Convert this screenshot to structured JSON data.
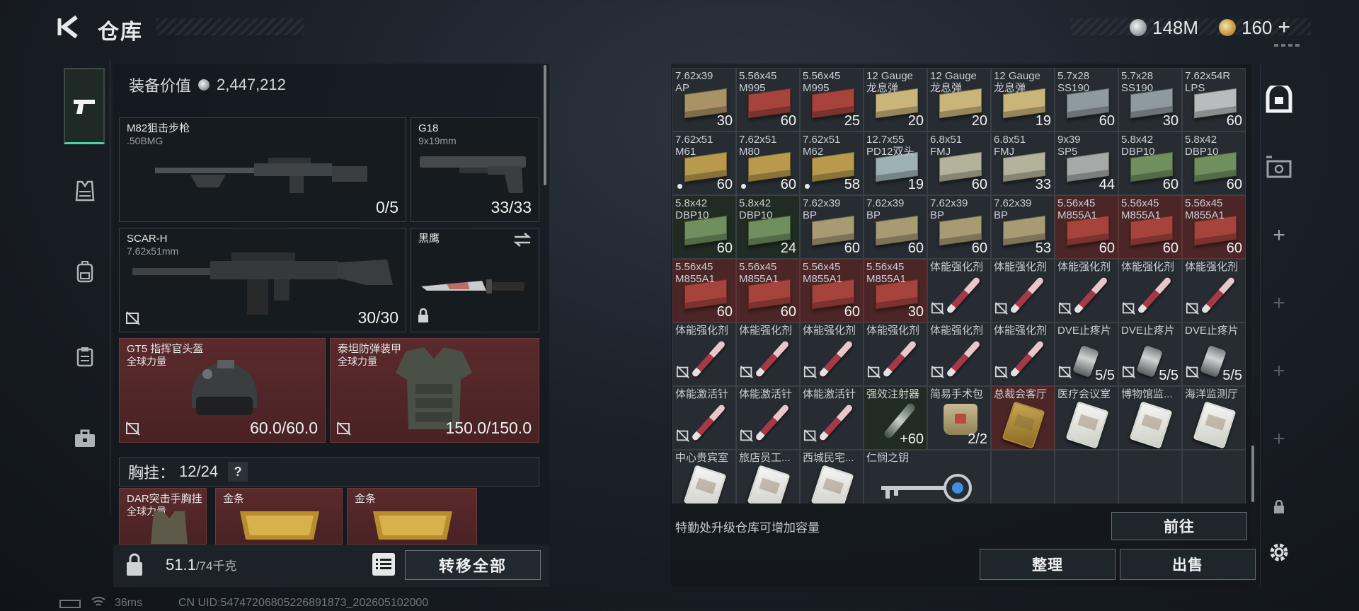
{
  "header": {
    "title": "仓库",
    "silver": "148M",
    "gold": "160"
  },
  "equipment": {
    "value_label": "装备价值",
    "value": "2,447,212",
    "primary1": {
      "name": "M82狙击步枪",
      "caliber": ".50BMG",
      "ammo": "0/5"
    },
    "sidearm": {
      "name": "G18",
      "caliber": "9x19mm",
      "ammo": "33/33"
    },
    "primary2": {
      "name": "SCAR-H",
      "caliber": "7.62x51mm",
      "ammo": "30/30"
    },
    "melee": {
      "name": "黑鹰"
    },
    "helmet": {
      "name": "GT5 指挥官头盔",
      "sub": "全球力量",
      "durability": "60.0/60.0"
    },
    "armor": {
      "name": "泰坦防弹装甲",
      "sub": "全球力量",
      "durability": "150.0/150.0"
    },
    "vest": {
      "label": "胸挂：",
      "count": "12/24"
    },
    "vest_items": [
      {
        "name": "DAR突击手胸挂",
        "sub": "全球力量"
      },
      {
        "name": "金条"
      },
      {
        "name": "金条"
      }
    ],
    "weight": "51.1",
    "weight_max": "/74千克",
    "transfer_all": "转移全部"
  },
  "status": {
    "ping": "36ms",
    "uid": "CN UID:54747206805226891873_202605102000"
  },
  "stash": {
    "rows": [
      [
        {
          "t": "7.62x39\nAP",
          "q": "30",
          "kind": "ammo",
          "color": "#a89266"
        },
        {
          "t": "5.56x45\nM995",
          "q": "60",
          "kind": "ammo",
          "color": "#a6433c"
        },
        {
          "t": "5.56x45\nM995",
          "q": "25",
          "kind": "ammo",
          "color": "#a6433c"
        },
        {
          "t": "12 Gauge\n龙息弹",
          "q": "20",
          "kind": "ammo",
          "color": "#c9b47a"
        },
        {
          "t": "12 Gauge\n龙息弹",
          "q": "20",
          "kind": "ammo",
          "color": "#c9b47a"
        },
        {
          "t": "12 Gauge\n龙息弹",
          "q": "19",
          "kind": "ammo",
          "color": "#c9b47a"
        },
        {
          "t": "5.7x28\nSS190",
          "q": "60",
          "kind": "ammo",
          "color": "#8f9aa0"
        },
        {
          "t": "5.7x28\nSS190",
          "q": "30",
          "kind": "ammo",
          "color": "#8f9aa0"
        },
        {
          "t": "7.62x54R\nLPS",
          "q": "60",
          "kind": "ammo",
          "color": "#b9bcbd"
        }
      ],
      [
        {
          "t": "7.62x51\nM61",
          "q": "60",
          "kind": "ammo",
          "color": "#b89a4c",
          "dot": true
        },
        {
          "t": "7.62x51\nM80",
          "q": "60",
          "kind": "ammo",
          "color": "#b89a4c",
          "dot": true
        },
        {
          "t": "7.62x51\nM62",
          "q": "58",
          "kind": "ammo",
          "color": "#b89a4c",
          "dot": true
        },
        {
          "t": "12.7x55\nPD12双头",
          "q": "19",
          "kind": "ammo",
          "color": "#9fb0b4"
        },
        {
          "t": "6.8x51\nFMJ",
          "q": "60",
          "kind": "ammo",
          "color": "#b4b29a"
        },
        {
          "t": "6.8x51\nFMJ",
          "q": "33",
          "kind": "ammo",
          "color": "#b4b29a"
        },
        {
          "t": "9x39\nSP5",
          "q": "44",
          "kind": "ammo",
          "color": "#a5a9a8"
        },
        {
          "t": "5.8x42\nDBP10",
          "q": "60",
          "kind": "ammo",
          "color": "#6f8f5e"
        },
        {
          "t": "5.8x42\nDBP10",
          "q": "60",
          "kind": "ammo",
          "color": "#6f8f5e"
        }
      ],
      [
        {
          "t": "5.8x42\nDBP10",
          "q": "60",
          "kind": "ammo",
          "color": "#6f8f5e",
          "cell": "green"
        },
        {
          "t": "5.8x42\nDBP10",
          "q": "24",
          "kind": "ammo",
          "color": "#6f8f5e",
          "cell": "green"
        },
        {
          "t": "7.62x39\nBP",
          "q": "60",
          "kind": "ammo",
          "color": "#a89a72"
        },
        {
          "t": "7.62x39\nBP",
          "q": "60",
          "kind": "ammo",
          "color": "#a89a72"
        },
        {
          "t": "7.62x39\nBP",
          "q": "60",
          "kind": "ammo",
          "color": "#a89a72"
        },
        {
          "t": "7.62x39\nBP",
          "q": "53",
          "kind": "ammo",
          "color": "#a89a72"
        },
        {
          "t": "5.56x45\nM855A1",
          "q": "60",
          "kind": "ammo",
          "color": "#a6433c",
          "cell": "red"
        },
        {
          "t": "5.56x45\nM855A1",
          "q": "60",
          "kind": "ammo",
          "color": "#a6433c",
          "cell": "red"
        },
        {
          "t": "5.56x45\nM855A1",
          "q": "60",
          "kind": "ammo",
          "color": "#a6433c",
          "cell": "red"
        }
      ],
      [
        {
          "t": "5.56x45\nM855A1",
          "q": "60",
          "kind": "ammo",
          "color": "#a6433c",
          "cell": "red"
        },
        {
          "t": "5.56x45\nM855A1",
          "q": "60",
          "kind": "ammo",
          "color": "#a6433c",
          "cell": "red"
        },
        {
          "t": "5.56x45\nM855A1",
          "q": "60",
          "kind": "ammo",
          "color": "#a6433c",
          "cell": "red"
        },
        {
          "t": "5.56x45\nM855A1",
          "q": "30",
          "kind": "ammo",
          "color": "#a6433c",
          "cell": "red"
        },
        {
          "t": "体能强化剂",
          "q": "",
          "kind": "syringe",
          "nd": true
        },
        {
          "t": "体能强化剂",
          "q": "",
          "kind": "syringe",
          "nd": true
        },
        {
          "t": "体能强化剂",
          "q": "",
          "kind": "syringe",
          "nd": true
        },
        {
          "t": "体能强化剂",
          "q": "",
          "kind": "syringe",
          "nd": true
        },
        {
          "t": "体能强化剂",
          "q": "",
          "kind": "syringe",
          "nd": true
        }
      ],
      [
        {
          "t": "体能强化剂",
          "q": "",
          "kind": "syringe",
          "nd": true
        },
        {
          "t": "体能强化剂",
          "q": "",
          "kind": "syringe",
          "nd": true
        },
        {
          "t": "体能强化剂",
          "q": "",
          "kind": "syringe",
          "nd": true
        },
        {
          "t": "体能强化剂",
          "q": "",
          "kind": "syringe",
          "nd": true
        },
        {
          "t": "体能强化剂",
          "q": "",
          "kind": "syringe",
          "nd": true
        },
        {
          "t": "体能强化剂",
          "q": "",
          "kind": "syringe",
          "nd": true
        },
        {
          "t": "DVE止疼片",
          "q": "5/5",
          "kind": "pill",
          "nd": true
        },
        {
          "t": "DVE止疼片",
          "q": "5/5",
          "kind": "pill",
          "nd": true
        },
        {
          "t": "DVE止疼片",
          "q": "5/5",
          "kind": "pill",
          "nd": true
        }
      ],
      [
        {
          "t": "体能激活针",
          "q": "",
          "kind": "syringe",
          "nd": true
        },
        {
          "t": "体能激活针",
          "q": "",
          "kind": "syringe",
          "nd": true
        },
        {
          "t": "体能激活针",
          "q": "",
          "kind": "syringe",
          "nd": true
        },
        {
          "t": "强效注射器",
          "q": "+60",
          "kind": "injector",
          "cell": "green"
        },
        {
          "t": "简易手术包",
          "q": "2/2",
          "kind": "bag"
        },
        {
          "t": "总裁会客厅",
          "q": "",
          "kind": "keycard-gold",
          "cell": "red"
        },
        {
          "t": "医疗会议室",
          "q": "",
          "kind": "keycard"
        },
        {
          "t": "博物馆监...",
          "q": "",
          "kind": "keycard"
        },
        {
          "t": "海洋监测厅",
          "q": "",
          "kind": "keycard"
        }
      ],
      [
        {
          "t": "中心贵宾室",
          "q": "",
          "kind": "keycard"
        },
        {
          "t": "旅店员工...",
          "q": "",
          "kind": "keycard"
        },
        {
          "t": "西城民宅...",
          "q": "",
          "kind": "keycard"
        },
        {
          "t": "仁悯之钥",
          "q": "",
          "kind": "key",
          "wide": true
        }
      ]
    ],
    "hint": "特勤处升级仓库可增加容量",
    "goto": "前往",
    "organize": "整理",
    "sell": "出售"
  },
  "icons": {
    "rail": [
      "pistol-icon",
      "vest-icon",
      "backpack-icon",
      "clipboard-icon",
      "toolbox-icon"
    ],
    "right_rail": [
      "safe-icon",
      "exchange-icon",
      "add-icon",
      "add-icon",
      "add-icon",
      "add-icon",
      "lock-icon",
      "settings-icon"
    ]
  }
}
